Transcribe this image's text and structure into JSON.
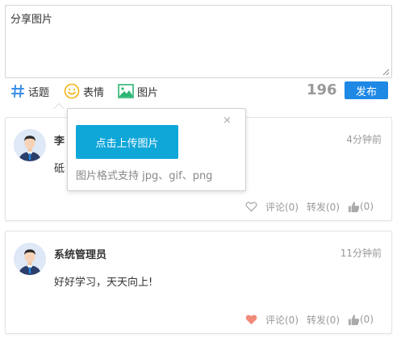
{
  "composer": {
    "text": "分享图片"
  },
  "toolbar": {
    "topic_label": "话题",
    "emoji_label": "表情",
    "image_label": "图片",
    "counter": "196",
    "publish_label": "发布"
  },
  "posts": [
    {
      "author": "李",
      "time": "4分钟前",
      "content": "砥",
      "comments": "评论(0)",
      "reposts": "转发(0)",
      "likes": "(0)",
      "liked": false
    },
    {
      "author": "系统管理员",
      "time": "11分钟前",
      "content": "好好学习，天天向上!",
      "comments": "评论(0)",
      "reposts": "转发(0)",
      "likes": "(0)",
      "liked": true
    }
  ],
  "popover": {
    "upload_label": "点击上传图片",
    "hint": "图片格式支持 jpg、gif、png",
    "close": "×"
  },
  "colors": {
    "publish": "#1e88e5",
    "upload": "#0fa6d8",
    "heart_liked": "#f08a7a",
    "topic_icon": "#3a8ee6",
    "emoji_icon": "#f5b31a",
    "image_icon": "#2bb673"
  }
}
